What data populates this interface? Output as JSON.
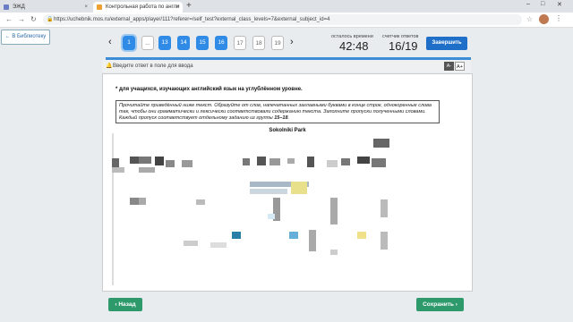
{
  "browser": {
    "tabs": [
      {
        "label": "ЭЖД",
        "close": "×"
      },
      {
        "label": "Контрольная работа по англи",
        "close": "×"
      }
    ],
    "new_tab": "+",
    "url": "https://uchebnik.mos.ru/external_apps/player/111?referer=/self_test?external_class_levels=7&external_subject_id=4",
    "icons": [
      "back-arrow-icon",
      "forward-arrow-icon",
      "reload-icon",
      "lock-icon",
      "star-icon",
      "menu-icon"
    ]
  },
  "nav": {
    "back_to_library": "← В Библиотеку"
  },
  "steps": {
    "prev": "‹",
    "next": "›",
    "items": [
      "1",
      "...",
      "13",
      "14",
      "15",
      "16",
      "17",
      "18",
      "19"
    ]
  },
  "timer": {
    "label": "осталось времени",
    "value": "42:48"
  },
  "counter": {
    "label": "счетчик ответов",
    "value": "16/19"
  },
  "finish_label": "Завершить",
  "hint": "Введите ответ в поле для ввода",
  "font_controls": {
    "decrease": "A-",
    "increase": "A+"
  },
  "task": {
    "note": "* для учащихся, изучающих английский язык на углублённом уровне.",
    "instruction_a": "Прочитайте приведённый ниже текст. Образуйте от слов, напечатанных заглавными буквами в конце строк, однокоренные слова так, чтобы они грамматически и лексически соответствовали содержанию текста. Заполните пропуски полученными словами. Каждый пропуск соответствует отдельному заданию из группы ",
    "instruction_b": "15–18",
    "instruction_c": ".",
    "text_title": "Sokolniki Park"
  },
  "footer": {
    "back": "‹ Назад",
    "save": "Сохранить ›"
  },
  "colors": {
    "primary": "#2f8be6",
    "finish": "#1f6fc9",
    "green": "#2e9a6b"
  }
}
